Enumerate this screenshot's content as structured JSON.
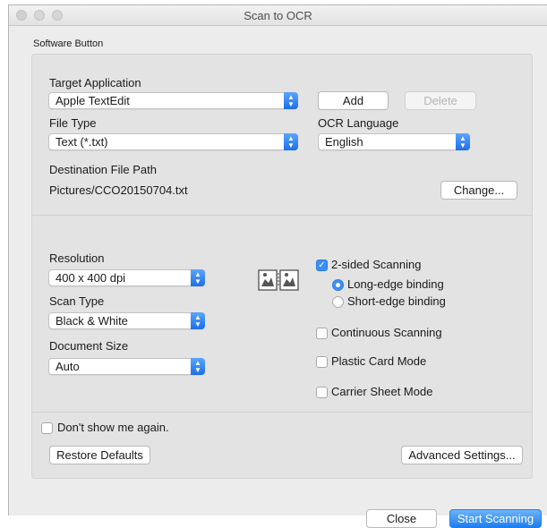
{
  "window": {
    "title": "Scan to OCR"
  },
  "software_button_label": "Software Button",
  "target_application": {
    "label": "Target Application",
    "value": "Apple TextEdit"
  },
  "buttons": {
    "add": "Add",
    "delete": "Delete",
    "change": "Change...",
    "restore_defaults": "Restore Defaults",
    "advanced_settings": "Advanced Settings...",
    "close": "Close",
    "start_scanning": "Start Scanning"
  },
  "file_type": {
    "label": "File Type",
    "value": "Text (*.txt)"
  },
  "ocr_language": {
    "label": "OCR Language",
    "value": "English"
  },
  "destination": {
    "label": "Destination File Path",
    "value": "Pictures/CCO20150704.txt"
  },
  "resolution": {
    "label": "Resolution",
    "value": "400 x 400 dpi"
  },
  "scan_type": {
    "label": "Scan Type",
    "value": "Black & White"
  },
  "document_size": {
    "label": "Document Size",
    "value": "Auto"
  },
  "options": {
    "two_sided": {
      "label": "2-sided Scanning",
      "checked": true
    },
    "long_edge": {
      "label": "Long-edge binding",
      "selected": true
    },
    "short_edge": {
      "label": "Short-edge binding",
      "selected": false
    },
    "continuous": {
      "label": "Continuous Scanning",
      "checked": false
    },
    "plastic_card": {
      "label": "Plastic Card Mode",
      "checked": false
    },
    "carrier_sheet": {
      "label": "Carrier Sheet Mode",
      "checked": false
    },
    "dont_show": {
      "label": "Don't show me again.",
      "checked": false
    }
  },
  "colors": {
    "accent": "#3a8ef6",
    "window_bg": "#ececec",
    "group_bg": "#e3e3e3"
  },
  "icons": {
    "binding_preview": "duplex-page-icon"
  }
}
